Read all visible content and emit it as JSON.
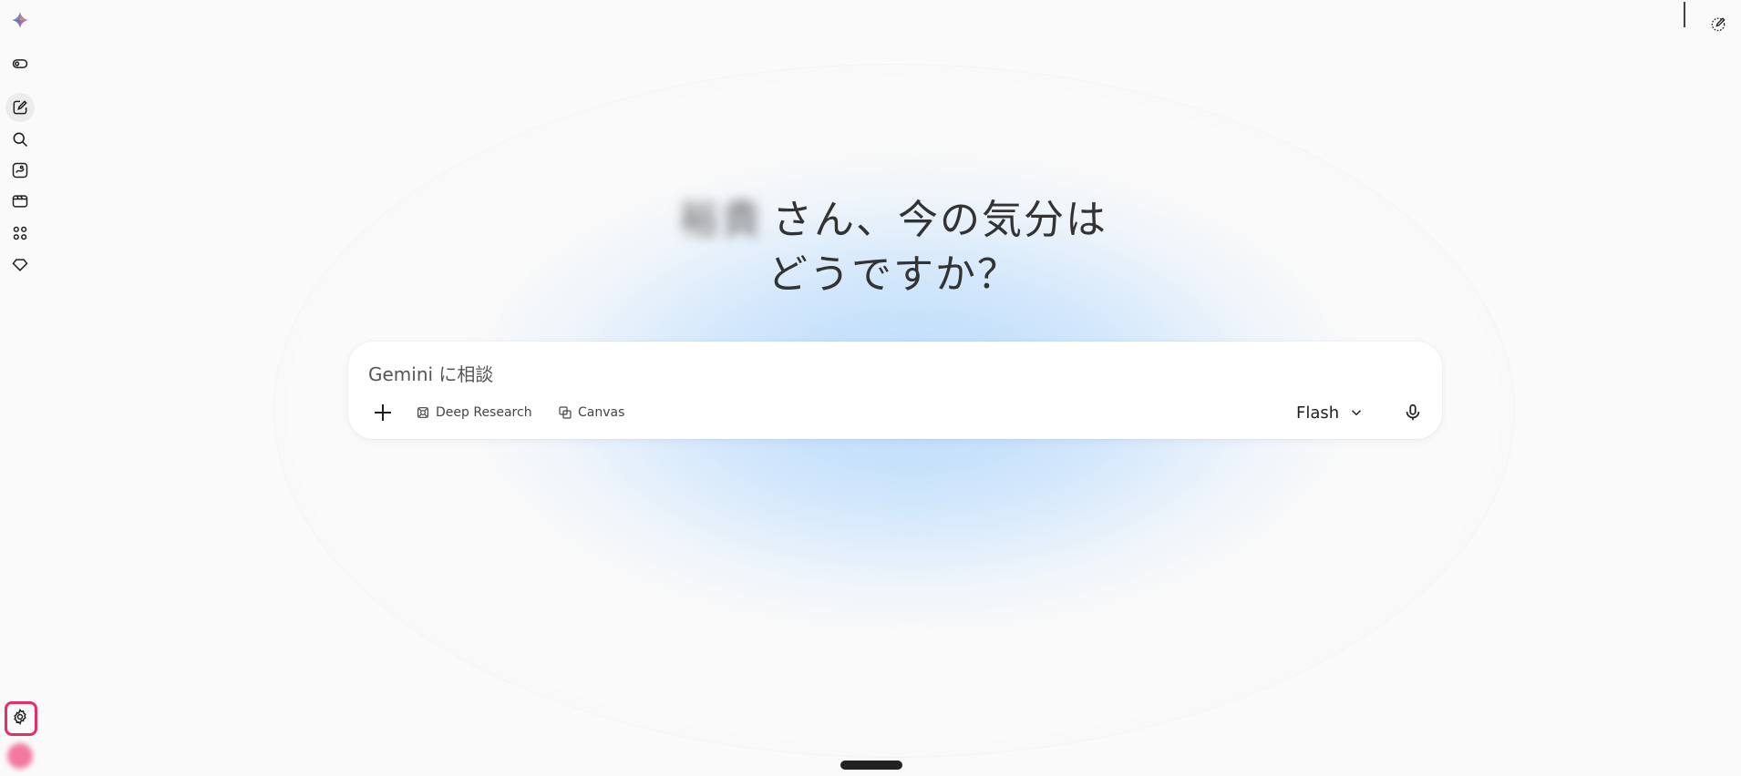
{
  "greeting": {
    "name": "裕貴",
    "line1_suffix": "さん、今の気分は",
    "line2": "どうですか？"
  },
  "composer": {
    "placeholder": "Gemini に相談",
    "tools": [
      {
        "label": "Deep Research",
        "icon": "deep-research-icon"
      },
      {
        "label": "Canvas",
        "icon": "canvas-icon"
      }
    ],
    "model": "Flash"
  },
  "sidebar": {
    "items": [
      {
        "icon": "gemini-logo-icon"
      },
      {
        "icon": "toggle-icon"
      },
      {
        "icon": "new-chat-icon",
        "active": true
      },
      {
        "icon": "search-icon"
      },
      {
        "icon": "gallery-icon"
      },
      {
        "icon": "video-icon"
      },
      {
        "icon": "apps-grid-icon"
      },
      {
        "icon": "gem-icon"
      },
      {
        "icon": "settings-icon",
        "highlighted": true
      }
    ]
  },
  "colors": {
    "highlight": "#e52e63",
    "glow": "#b2d7fc",
    "background": "#fafafa"
  }
}
